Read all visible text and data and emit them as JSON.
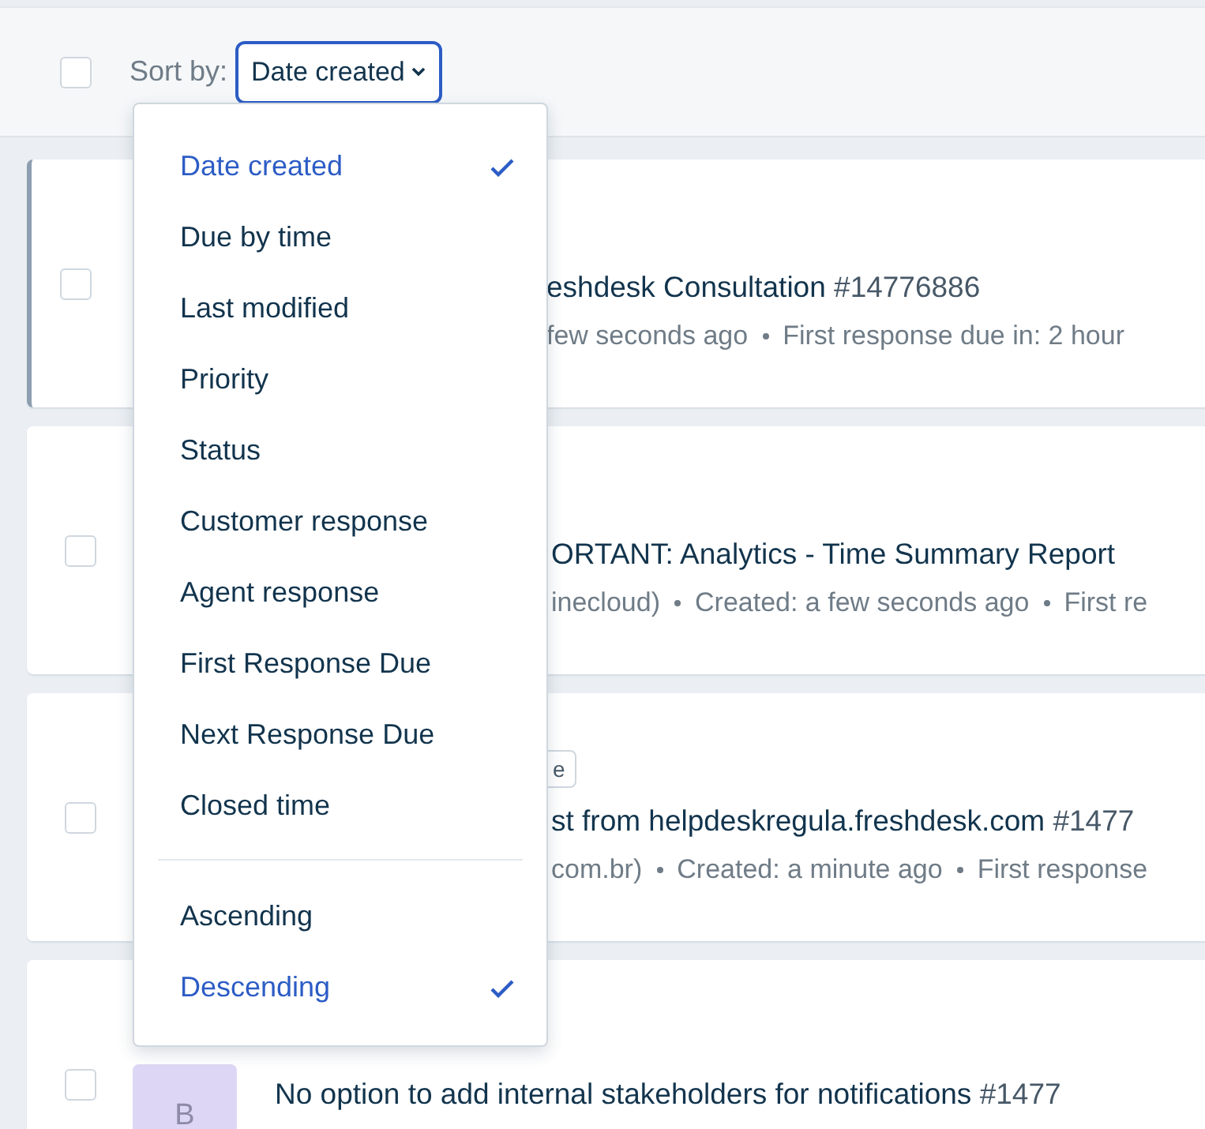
{
  "toolbar": {
    "select_all": {
      "checked": false
    },
    "sort_label": "Sort by:",
    "sort_value": "Date created"
  },
  "sort_menu": {
    "fields": [
      {
        "label": "Date created",
        "selected": true
      },
      {
        "label": "Due by time",
        "selected": false
      },
      {
        "label": "Last modified",
        "selected": false
      },
      {
        "label": "Priority",
        "selected": false
      },
      {
        "label": "Status",
        "selected": false
      },
      {
        "label": "Customer response",
        "selected": false
      },
      {
        "label": "Agent response",
        "selected": false
      },
      {
        "label": "First Response Due",
        "selected": false
      },
      {
        "label": "Next Response Due",
        "selected": false
      },
      {
        "label": "Closed time",
        "selected": false
      }
    ],
    "orders": [
      {
        "label": "Ascending",
        "selected": false
      },
      {
        "label": "Descending",
        "selected": true
      }
    ]
  },
  "tickets": [
    {
      "active": true,
      "checked": false,
      "title": "eshdesk Consultation",
      "number": "#14776886",
      "meta": [
        "few seconds ago",
        "First response due in: 2 hour"
      ]
    },
    {
      "active": false,
      "checked": false,
      "title": "ORTANT: Analytics - Time Summary Report",
      "meta": [
        "inecloud)",
        "Created: a few seconds ago",
        "First re"
      ]
    },
    {
      "active": false,
      "checked": false,
      "tag": "e",
      "title": "st from helpdeskregula.freshdesk.com",
      "number": "#1477",
      "meta": [
        "com.br)",
        "Created: a minute ago",
        "First response"
      ]
    },
    {
      "active": false,
      "checked": false,
      "avatar": {
        "letter": "B",
        "color": "#ddd7f5"
      },
      "title": "No option to add internal stakeholders for notifications",
      "number": "#1477"
    }
  ]
}
